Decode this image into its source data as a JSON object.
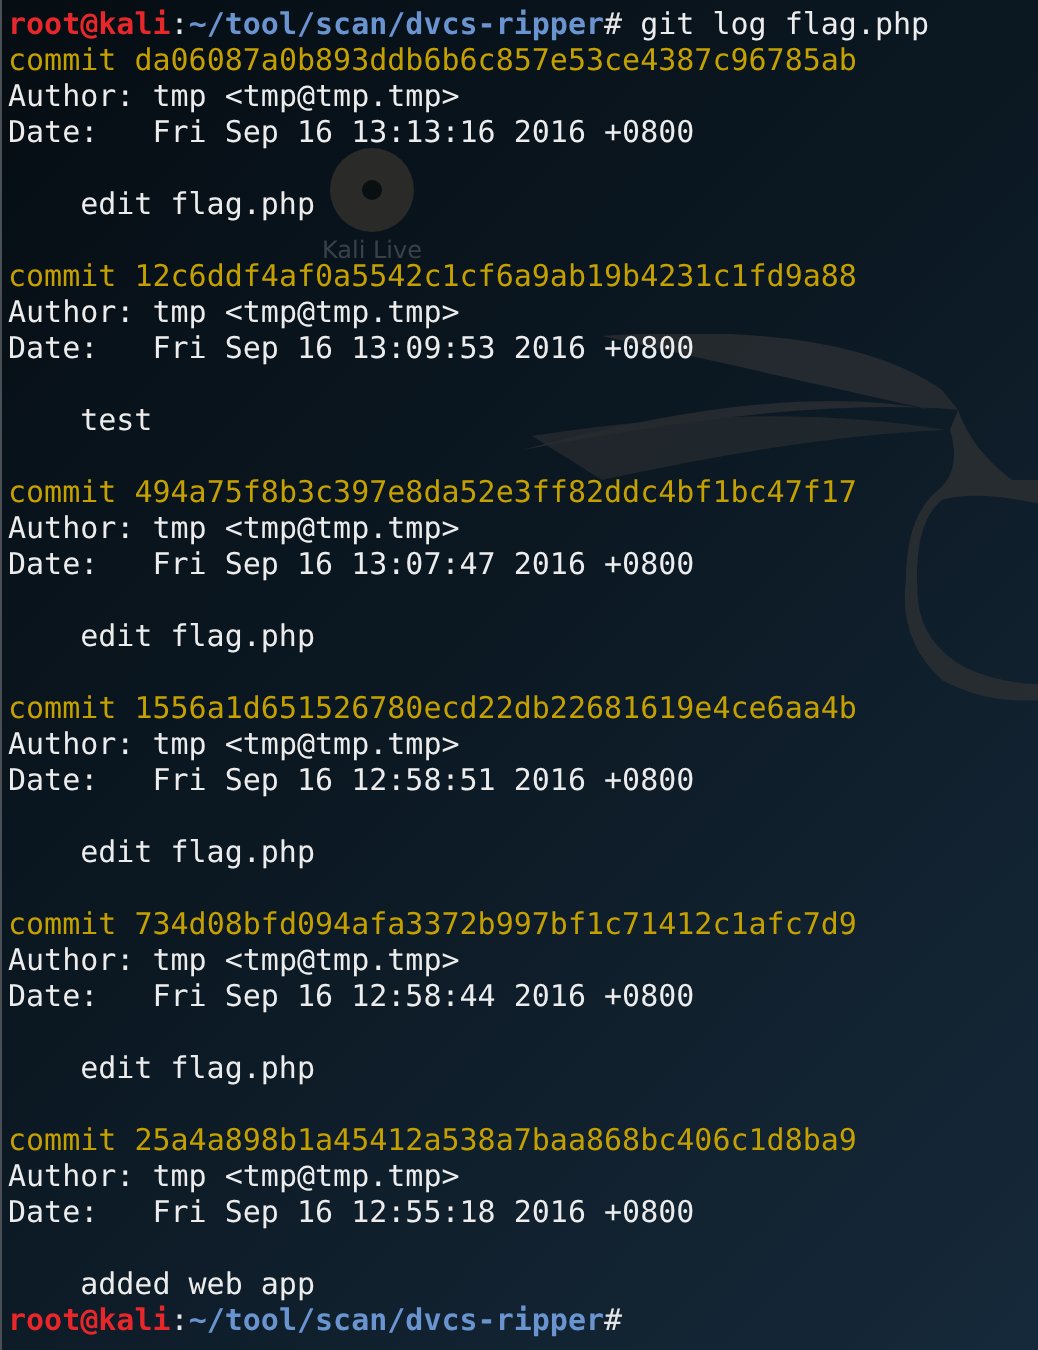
{
  "prompt": {
    "user_host": "root@kali",
    "separator": ":",
    "path": "~/tool/scan/dvcs-ripper",
    "symbol": "#",
    "command": "git log flag.php"
  },
  "commits": [
    {
      "commit_line": "commit da06087a0b893ddb6b6c857e53ce4387c96785ab",
      "author_line": "Author: tmp <tmp@tmp.tmp>",
      "date_line": "Date:   Fri Sep 16 13:13:16 2016 +0800",
      "message": "edit flag.php"
    },
    {
      "commit_line": "commit 12c6ddf4af0a5542c1cf6a9ab19b4231c1fd9a88",
      "author_line": "Author: tmp <tmp@tmp.tmp>",
      "date_line": "Date:   Fri Sep 16 13:09:53 2016 +0800",
      "message": "test"
    },
    {
      "commit_line": "commit 494a75f8b3c397e8da52e3ff82ddc4bf1bc47f17",
      "author_line": "Author: tmp <tmp@tmp.tmp>",
      "date_line": "Date:   Fri Sep 16 13:07:47 2016 +0800",
      "message": "edit flag.php"
    },
    {
      "commit_line": "commit 1556a1d651526780ecd22db22681619e4ce6aa4b",
      "author_line": "Author: tmp <tmp@tmp.tmp>",
      "date_line": "Date:   Fri Sep 16 12:58:51 2016 +0800",
      "message": "edit flag.php"
    },
    {
      "commit_line": "commit 734d08bfd094afa3372b997bf1c71412c1afc7d9",
      "author_line": "Author: tmp <tmp@tmp.tmp>",
      "date_line": "Date:   Fri Sep 16 12:58:44 2016 +0800",
      "message": "edit flag.php"
    },
    {
      "commit_line": "commit 25a4a898b1a45412a538a7baa868bc406c1d8ba9",
      "author_line": "Author: tmp <tmp@tmp.tmp>",
      "date_line": "Date:   Fri Sep 16 12:55:18 2016 +0800",
      "message": "added web app"
    }
  ],
  "final_prompt": {
    "user_host": "root@kali",
    "separator": ":",
    "path": "~/tool/scan/dvcs-ripper",
    "symbol": "#"
  },
  "desktop_icon": {
    "label": "Kali Live"
  }
}
